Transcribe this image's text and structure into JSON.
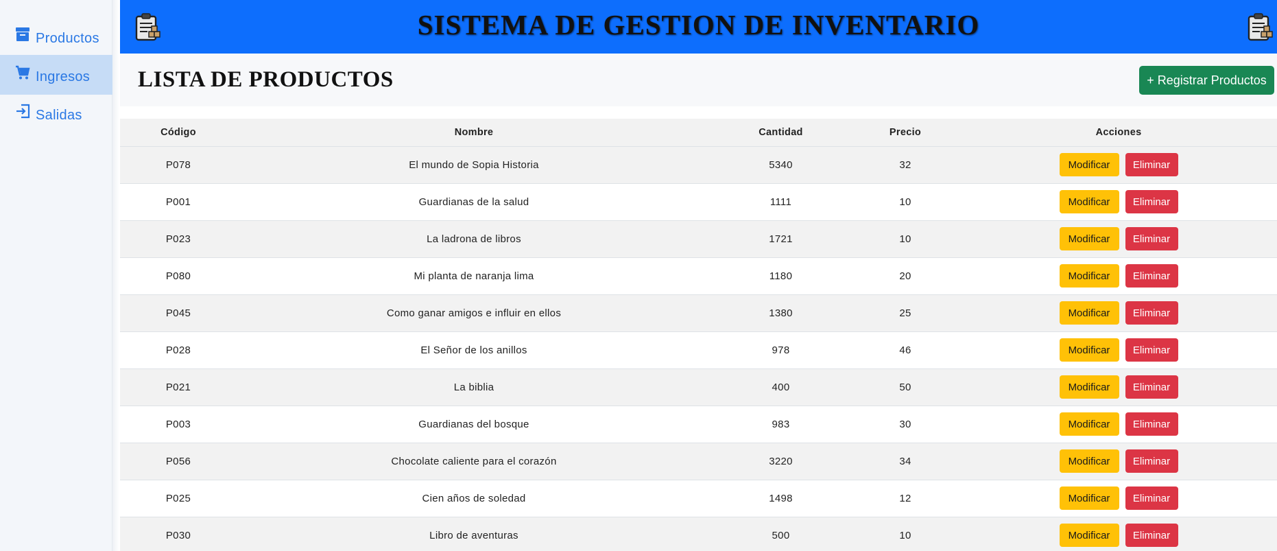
{
  "sidebar": {
    "items": [
      {
        "label": "Productos",
        "icon": "archive-box-icon",
        "active": false
      },
      {
        "label": "Ingresos",
        "icon": "shopping-cart-icon",
        "active": true
      },
      {
        "label": "Salidas",
        "icon": "exit-arrow-icon",
        "active": false
      }
    ]
  },
  "header": {
    "title": "SISTEMA DE GESTION DE INVENTARIO",
    "logo_icon": "clipboard-inventory-icon"
  },
  "page": {
    "title": "LISTA DE PRODUCTOS",
    "register_button": "+ Registrar Productos"
  },
  "table": {
    "columns": [
      "Código",
      "Nombre",
      "Cantidad",
      "Precio",
      "Acciones"
    ],
    "edit_label": "Modificar",
    "delete_label": "Eliminar",
    "rows": [
      {
        "code": "P078",
        "name": "El mundo de Sopia Historia",
        "qty": "5340",
        "price": "32"
      },
      {
        "code": "P001",
        "name": "Guardianas de la salud",
        "qty": "1111",
        "price": "10"
      },
      {
        "code": "P023",
        "name": "La ladrona de libros",
        "qty": "1721",
        "price": "10"
      },
      {
        "code": "P080",
        "name": "Mi planta de naranja lima",
        "qty": "1180",
        "price": "20"
      },
      {
        "code": "P045",
        "name": "Como ganar amigos e influir en ellos",
        "qty": "1380",
        "price": "25"
      },
      {
        "code": "P028",
        "name": "El Señor de los anillos",
        "qty": "978",
        "price": "46"
      },
      {
        "code": "P021",
        "name": "La biblia",
        "qty": "400",
        "price": "50"
      },
      {
        "code": "P003",
        "name": "Guardianas del bosque",
        "qty": "983",
        "price": "30"
      },
      {
        "code": "P056",
        "name": "Chocolate caliente para el corazón",
        "qty": "3220",
        "price": "34"
      },
      {
        "code": "P025",
        "name": "Cien años de soledad",
        "qty": "1498",
        "price": "12"
      },
      {
        "code": "P030",
        "name": "Libro de aventuras",
        "qty": "500",
        "price": "10"
      }
    ]
  },
  "colors": {
    "primary": "#0d6efd",
    "success": "#198754",
    "warning": "#ffc107",
    "danger": "#dc3545",
    "sidebar_link": "#2a78e4"
  }
}
